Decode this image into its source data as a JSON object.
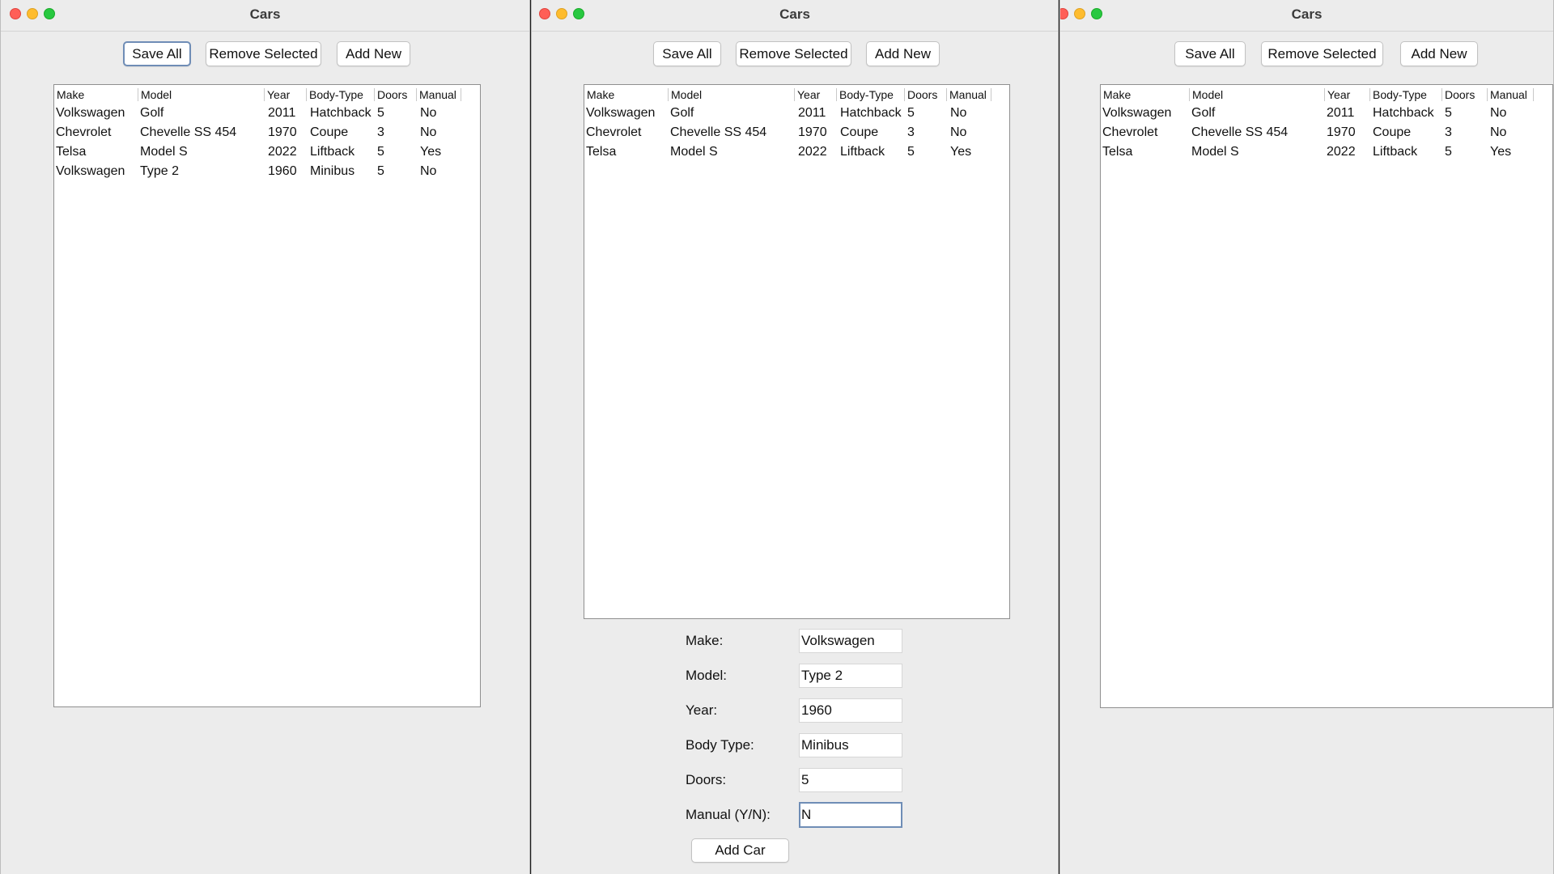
{
  "windows": [
    {
      "title": "Cars",
      "buttons": {
        "save_all": "Save All",
        "remove_selected": "Remove Selected",
        "add_new": "Add New"
      },
      "columns": [
        "Make",
        "Model",
        "Year",
        "Body-Type",
        "Doors",
        "Manual"
      ],
      "rows": [
        [
          "Volkswagen",
          "Golf",
          "2011",
          "Hatchback",
          "5",
          "No"
        ],
        [
          "Chevrolet",
          "Chevelle SS 454",
          "1970",
          "Coupe",
          "3",
          "No"
        ],
        [
          "Telsa",
          "Model S",
          "2022",
          "Liftback",
          "5",
          "Yes"
        ],
        [
          "Volkswagen",
          "Type 2",
          "1960",
          "Minibus",
          "5",
          "No"
        ]
      ]
    },
    {
      "title": "Cars",
      "buttons": {
        "save_all": "Save All",
        "remove_selected": "Remove Selected",
        "add_new": "Add New"
      },
      "columns": [
        "Make",
        "Model",
        "Year",
        "Body-Type",
        "Doors",
        "Manual"
      ],
      "rows": [
        [
          "Volkswagen",
          "Golf",
          "2011",
          "Hatchback",
          "5",
          "No"
        ],
        [
          "Chevrolet",
          "Chevelle SS 454",
          "1970",
          "Coupe",
          "3",
          "No"
        ],
        [
          "Telsa",
          "Model S",
          "2022",
          "Liftback",
          "5",
          "Yes"
        ]
      ],
      "form": {
        "make_label": "Make:",
        "make_value": "Volkswagen",
        "model_label": "Model:",
        "model_value": "Type 2",
        "year_label": "Year:",
        "year_value": "1960",
        "body_type_label": "Body Type:",
        "body_type_value": "Minibus",
        "doors_label": "Doors:",
        "doors_value": "5",
        "manual_label": "Manual (Y/N):",
        "manual_value": "N",
        "add_car_label": "Add Car"
      }
    },
    {
      "title": "Cars",
      "buttons": {
        "save_all": "Save All",
        "remove_selected": "Remove Selected",
        "add_new": "Add New"
      },
      "columns": [
        "Make",
        "Model",
        "Year",
        "Body-Type",
        "Doors",
        "Manual"
      ],
      "rows": [
        [
          "Volkswagen",
          "Golf",
          "2011",
          "Hatchback",
          "5",
          "No"
        ],
        [
          "Chevrolet",
          "Chevelle SS 454",
          "1970",
          "Coupe",
          "3",
          "No"
        ],
        [
          "Telsa",
          "Model S",
          "2022",
          "Liftback",
          "5",
          "Yes"
        ]
      ]
    }
  ]
}
